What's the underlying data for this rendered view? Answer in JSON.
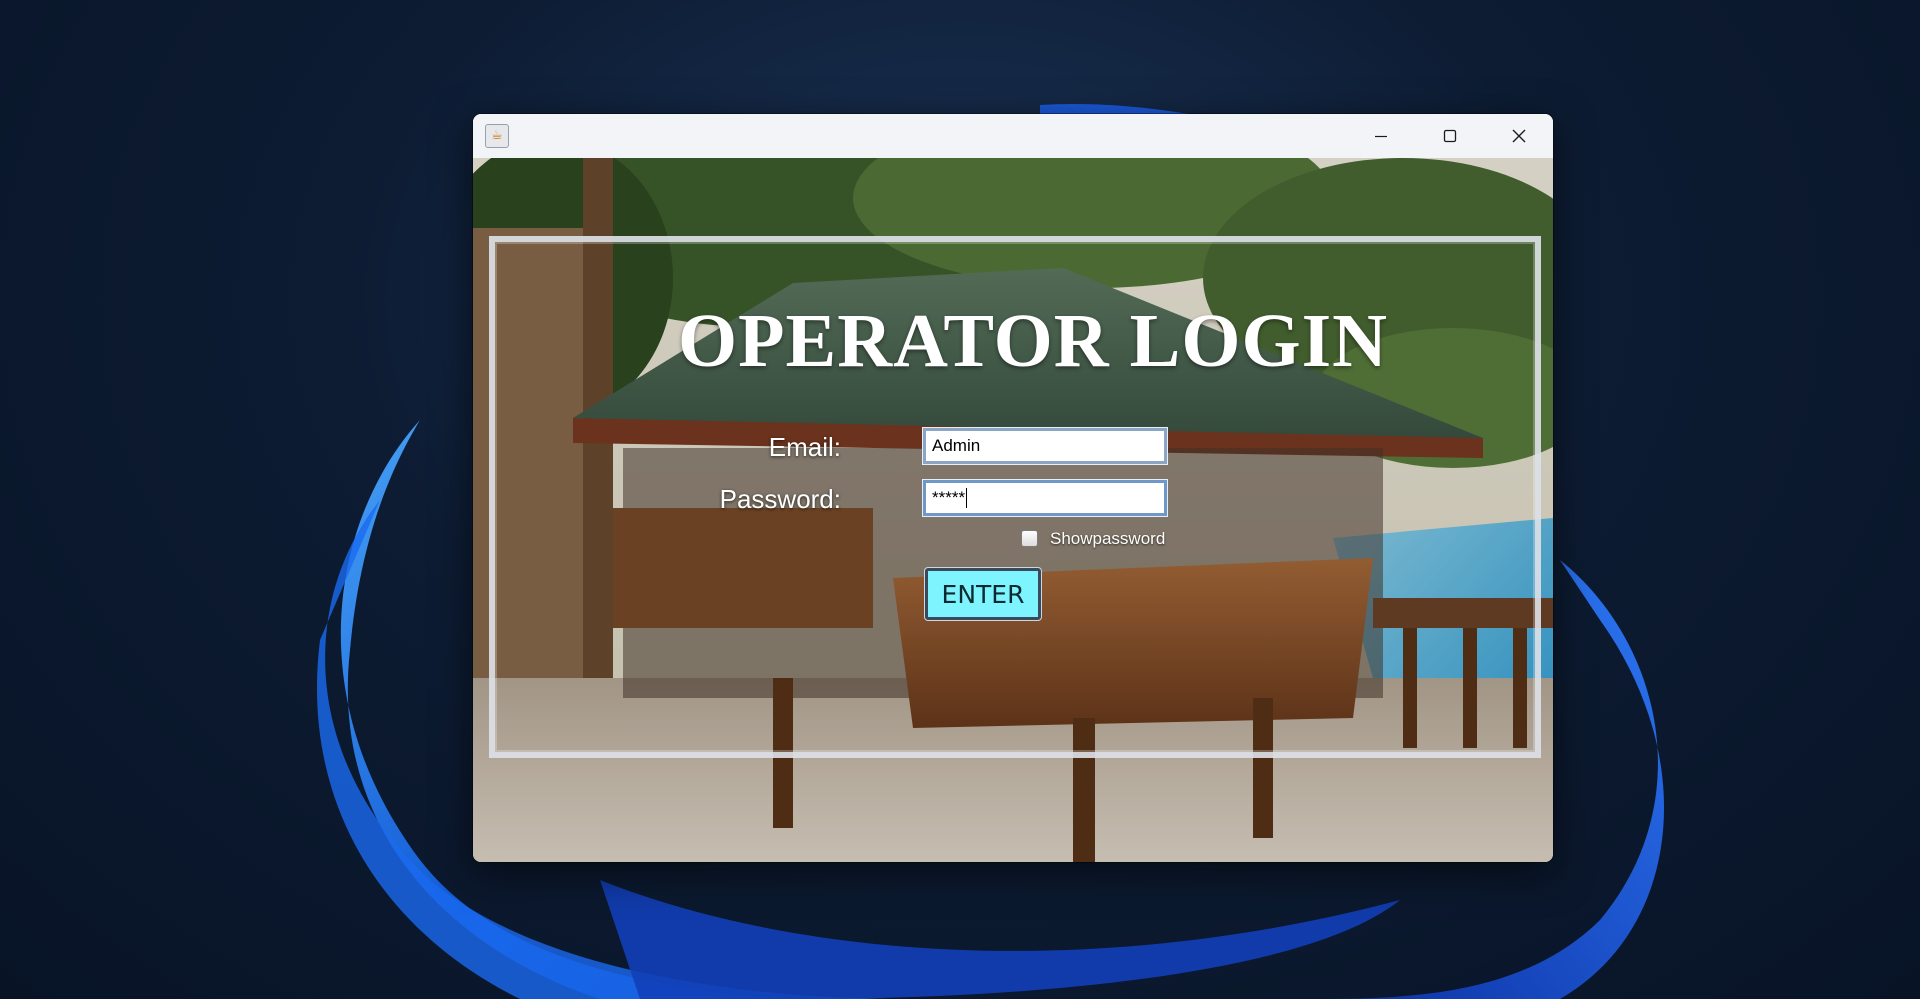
{
  "window": {
    "controls": {
      "minimize_icon": "minimize-icon",
      "maximize_icon": "maximize-icon",
      "close_icon": "close-icon"
    },
    "app_icon": "java-coffee-cup-icon"
  },
  "login": {
    "heading": "OPERATOR LOGIN",
    "email_label": "Email:",
    "email_value": "Admin",
    "password_label": "Password:",
    "password_value": "*****",
    "show_password_label": "Showpassword",
    "show_password_checked": false,
    "enter_label": "ENTER"
  },
  "colors": {
    "enter_button": "#7ef4ff",
    "desktop_background": "#0d1c33",
    "titlebar": "#f2f4f8"
  }
}
